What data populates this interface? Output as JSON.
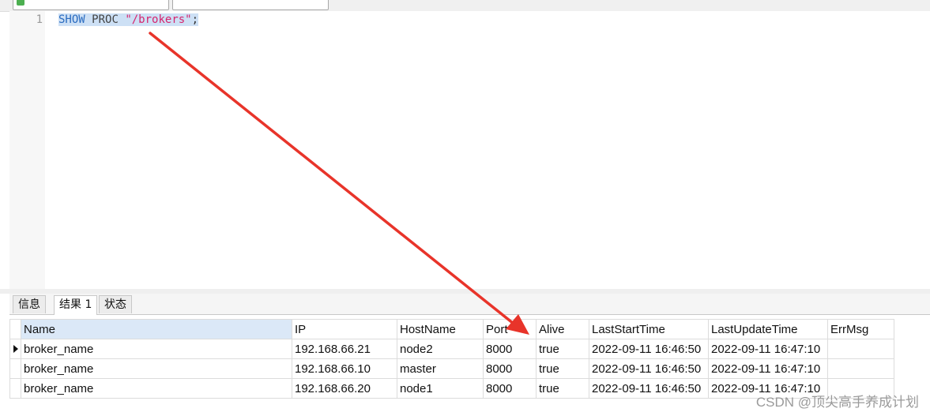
{
  "editor": {
    "line_number": "1",
    "tokens": {
      "kw_show": "SHOW",
      "kw_proc": "PROC",
      "string": "\"/brokers\"",
      "semicolon": ";"
    }
  },
  "tabs": [
    {
      "label": "信息",
      "active": false
    },
    {
      "label": "结果 1",
      "active": true
    },
    {
      "label": "状态",
      "active": false
    }
  ],
  "result_grid": {
    "columns": [
      "Name",
      "IP",
      "HostName",
      "Port",
      "Alive",
      "LastStartTime",
      "LastUpdateTime",
      "ErrMsg"
    ],
    "rows": [
      [
        "broker_name",
        "192.168.66.21",
        "node2",
        "8000",
        "true",
        "2022-09-11 16:46:50",
        "2022-09-11 16:47:10",
        ""
      ],
      [
        "broker_name",
        "192.168.66.10",
        "master",
        "8000",
        "true",
        "2022-09-11 16:46:50",
        "2022-09-11 16:47:10",
        ""
      ],
      [
        "broker_name",
        "192.168.66.20",
        "node1",
        "8000",
        "true",
        "2022-09-11 16:46:50",
        "2022-09-11 16:47:10",
        ""
      ]
    ],
    "current_row": 0
  },
  "watermark": "CSDN @顶尖高手养成计划",
  "colors": {
    "keyword": "#2b6cc0",
    "string": "#d6246e",
    "selection": "#cde0f5",
    "annotation_arrow": "#e8342a"
  },
  "icons": {
    "db": "database-icon",
    "row_marker": "current-row-arrow-icon"
  }
}
